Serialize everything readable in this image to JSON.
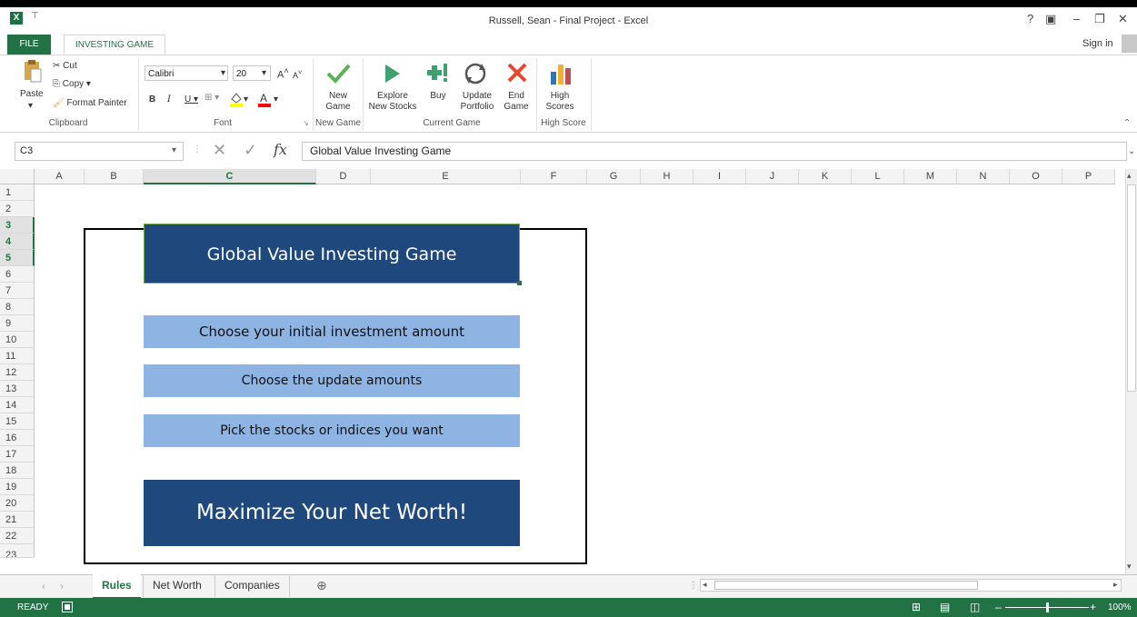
{
  "window": {
    "title": "Russell, Sean - Final Project - Excel",
    "app_icon": "X",
    "qat": "⊤",
    "sign_in": "Sign in",
    "controls": [
      "?",
      "▣",
      "–",
      "❐",
      "✕"
    ]
  },
  "tabs": {
    "file": "FILE",
    "investing_game": "INVESTING GAME"
  },
  "ribbon": {
    "clipboard": {
      "paste": "Paste",
      "cut": "Cut",
      "copy": "Copy",
      "format_painter": "Format Painter",
      "label": "Clipboard"
    },
    "font": {
      "name": "Calibri",
      "size": "20",
      "label": "Font"
    },
    "new_game": {
      "button": "New\nGame",
      "label": "New Game"
    },
    "current_game": {
      "explore": "Explore\nNew Stocks",
      "buy": "Buy",
      "update": "Update\nPortfolio",
      "end": "End\nGame",
      "label": "Current Game"
    },
    "high_score": {
      "button": "High\nScores",
      "label": "High Score"
    },
    "colors": {
      "check": "#5bb058",
      "play": "#3f9f6e",
      "buy": "#3f9f6e",
      "end": "#e8472d"
    }
  },
  "formula_bar": {
    "name_box": "C3",
    "fx": "fx",
    "content": "Global Value Investing Game"
  },
  "columns": [
    "A",
    "B",
    "C",
    "D",
    "E",
    "F",
    "G",
    "H",
    "I",
    "J",
    "K",
    "L",
    "M",
    "N",
    "O",
    "P"
  ],
  "rows": [
    "1",
    "2",
    "3",
    "4",
    "5",
    "6",
    "7",
    "8",
    "9",
    "10",
    "11",
    "12",
    "13",
    "14",
    "15",
    "16",
    "17",
    "18",
    "19",
    "20",
    "21",
    "22",
    "23"
  ],
  "sheet": {
    "title_shape": "Global Value Investing Game",
    "step1": "Choose your initial investment amount",
    "step2": "Choose the update amounts",
    "step3": "Pick the stocks or indices you want",
    "goal": "Maximize Your Net Worth!"
  },
  "sheet_tabs": [
    "Rules",
    "Net Worth",
    "Companies"
  ],
  "status": {
    "ready": "READY",
    "zoom": "100%"
  }
}
